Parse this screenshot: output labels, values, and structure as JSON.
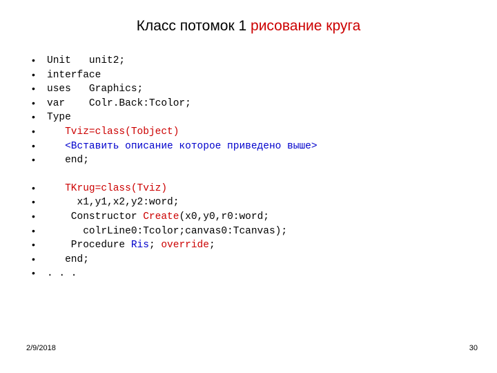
{
  "slide": {
    "title": {
      "part_black": "Класс потомок 1 ",
      "part_red": "рисование круга"
    },
    "accent_color": "#cc0000",
    "keyword_color": "#0000cc",
    "code_lines": [
      {
        "bullet": true,
        "segments": [
          {
            "text": "Unit   unit2;",
            "color": "black"
          }
        ]
      },
      {
        "bullet": true,
        "segments": [
          {
            "text": "interface",
            "color": "black"
          }
        ]
      },
      {
        "bullet": true,
        "segments": [
          {
            "text": "uses   Graphics;",
            "color": "black"
          }
        ]
      },
      {
        "bullet": true,
        "segments": [
          {
            "text": "var    Colr.Back:Tcolor;",
            "color": "black"
          }
        ]
      },
      {
        "bullet": true,
        "segments": [
          {
            "text": "Type",
            "color": "black"
          }
        ]
      },
      {
        "bullet": true,
        "segments": [
          {
            "text": "   Tviz=class(Tobject)",
            "color": "red"
          }
        ]
      },
      {
        "bullet": true,
        "segments": [
          {
            "text": "   <Вставить описание которое приведено выше>",
            "color": "blue"
          }
        ]
      },
      {
        "bullet": true,
        "segments": [
          {
            "text": "   end;",
            "color": "black"
          }
        ]
      },
      {
        "bullet": false,
        "spacer": true,
        "segments": []
      },
      {
        "bullet": true,
        "segments": [
          {
            "text": "   TKrug=class(Tviz)",
            "color": "red"
          }
        ]
      },
      {
        "bullet": true,
        "segments": [
          {
            "text": "     x1,y1,x2,y2:word;",
            "color": "black"
          }
        ]
      },
      {
        "bullet": true,
        "segments": [
          {
            "text": "    Constructor ",
            "color": "black"
          },
          {
            "text": "Create",
            "color": "red"
          },
          {
            "text": "(x0,y0,r0:word;",
            "color": "black"
          }
        ]
      },
      {
        "bullet": true,
        "segments": [
          {
            "text": "      colrLine0:Tcolor;canvas0:Tcanvas);",
            "color": "black"
          }
        ]
      },
      {
        "bullet": true,
        "segments": [
          {
            "text": "    Procedure ",
            "color": "black"
          },
          {
            "text": "Ris",
            "color": "blue"
          },
          {
            "text": "; ",
            "color": "black"
          },
          {
            "text": "override",
            "color": "red"
          },
          {
            "text": ";",
            "color": "black"
          }
        ]
      },
      {
        "bullet": true,
        "segments": [
          {
            "text": "   end;",
            "color": "black"
          }
        ]
      },
      {
        "bullet": true,
        "segments": [
          {
            "text": ". . .",
            "color": "black"
          }
        ]
      }
    ],
    "footer": {
      "date": "2/9/2018",
      "page_number": "30"
    }
  }
}
